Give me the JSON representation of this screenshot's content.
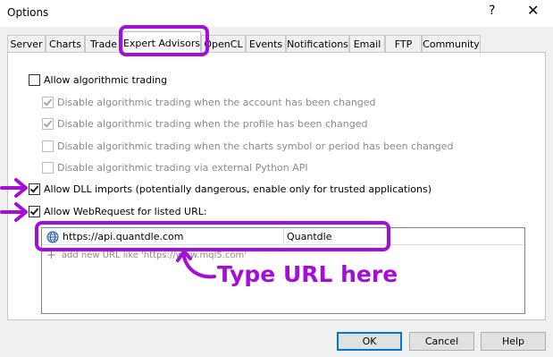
{
  "window": {
    "title": "Options",
    "help_glyph": "?",
    "close_glyph": "✕"
  },
  "tabs": [
    {
      "label": "Server"
    },
    {
      "label": "Charts"
    },
    {
      "label": "Trade"
    },
    {
      "label": "Expert Advisors",
      "active": true
    },
    {
      "label": "OpenCL"
    },
    {
      "label": "Events"
    },
    {
      "label": "Notifications"
    },
    {
      "label": "Email"
    },
    {
      "label": "FTP"
    },
    {
      "label": "Community"
    }
  ],
  "options": {
    "allow_algo": {
      "label": "Allow algorithmic trading",
      "checked": false,
      "enabled": true
    },
    "disable_account": {
      "label": "Disable algorithmic trading when the account has been changed",
      "checked": true,
      "enabled": false
    },
    "disable_profile": {
      "label": "Disable algorithmic trading when the profile has been changed",
      "checked": true,
      "enabled": false
    },
    "disable_symbol": {
      "label": "Disable algorithmic trading when the charts symbol or period has been changed",
      "checked": false,
      "enabled": false
    },
    "disable_python": {
      "label": "Disable algorithmic trading via external Python API",
      "checked": false,
      "enabled": false
    },
    "allow_dll": {
      "label": "Allow DLL imports (potentially dangerous, enable only for trusted applications)",
      "checked": true,
      "enabled": true
    },
    "allow_webrequest": {
      "label": "Allow WebRequest for listed URL:",
      "checked": true,
      "enabled": true
    }
  },
  "url_list": {
    "rows": [
      {
        "url": "https://api.quantdle.com",
        "name": "Quantdle",
        "icon": "globe-icon"
      }
    ],
    "add_hint": "add new URL like 'https://www.mql5.com'",
    "add_icon": "plus-icon"
  },
  "annotation": {
    "text": "Type URL here",
    "color": "#a40ed6"
  },
  "buttons": {
    "ok": "OK",
    "cancel": "Cancel",
    "help": "Help"
  },
  "colors": {
    "accent_annotation": "#a40ed6",
    "ok_border": "#0078d7",
    "disabled_text": "#8a8a8a"
  }
}
